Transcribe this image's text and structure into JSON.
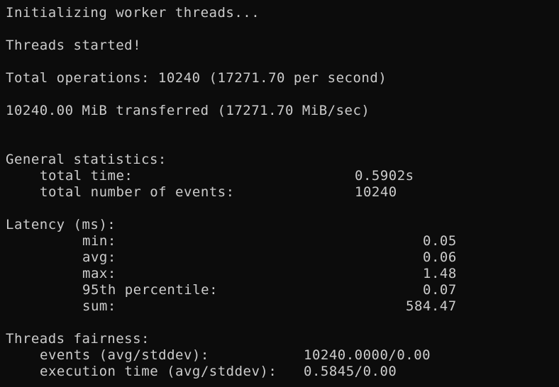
{
  "terminal": {
    "init": "Initializing worker threads...",
    "started": "Threads started!",
    "total_ops": "Total operations: 10240 (17271.70 per second)",
    "transferred": "10240.00 MiB transferred (17271.70 MiB/sec)",
    "general": {
      "header": "General statistics:",
      "total_time_label": "total time:",
      "total_time_value": "0.5902s",
      "events_label": "total number of events:",
      "events_value": "10240"
    },
    "latency": {
      "header": "Latency (ms):",
      "min_label": "min:",
      "min_value": "0.05",
      "avg_label": "avg:",
      "avg_value": "0.06",
      "max_label": "max:",
      "max_value": "1.48",
      "p95_label": "95th percentile:",
      "p95_value": "0.07",
      "sum_label": "sum:",
      "sum_value": "584.47"
    },
    "fairness": {
      "header": "Threads fairness:",
      "events_label": "events (avg/stddev):",
      "events_value": "10240.0000/0.00",
      "exec_label": "execution time (avg/stddev):",
      "exec_value": "0.5845/0.00"
    }
  }
}
